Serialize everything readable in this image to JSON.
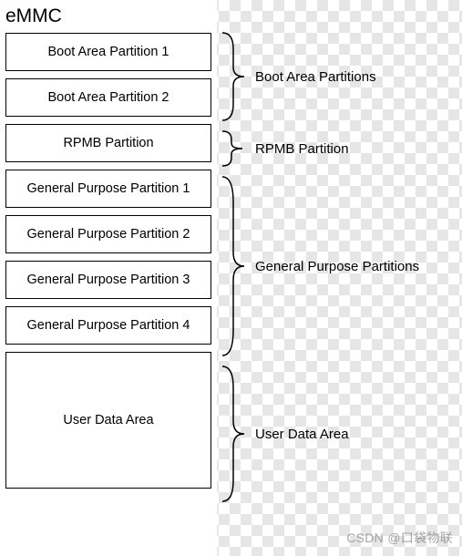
{
  "title": "eMMC",
  "partitions": {
    "boot1": "Boot Area Partition 1",
    "boot2": "Boot Area Partition 2",
    "rpmb": "RPMB Partition",
    "gpp1": "General Purpose Partition 1",
    "gpp2": "General Purpose Partition 2",
    "gpp3": "General Purpose Partition 3",
    "gpp4": "General Purpose Partition 4",
    "uda": "User Data Area"
  },
  "groups": {
    "boot": "Boot Area Partitions",
    "rpmb": "RPMB Partition",
    "gpp": "General Purpose Partitions",
    "uda": "User Data Area"
  },
  "watermark": "CSDN @口袋物联"
}
